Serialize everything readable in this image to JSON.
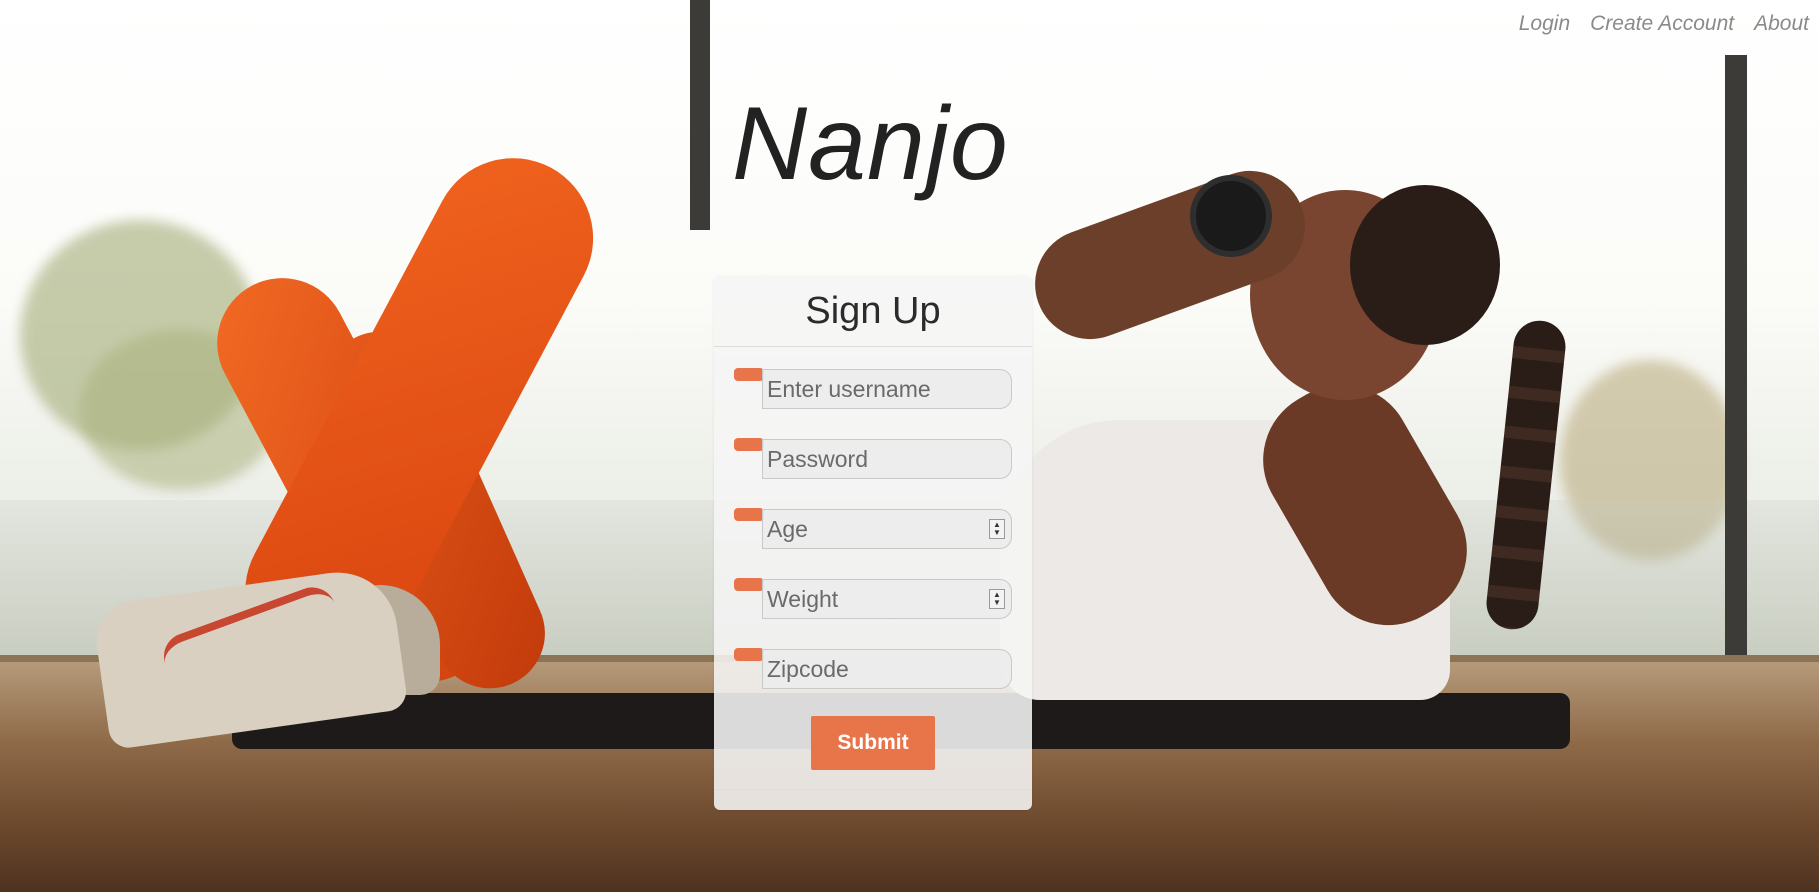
{
  "nav": {
    "links": [
      "Login",
      "Create Account",
      "About"
    ]
  },
  "brand": {
    "title": "Nanjo"
  },
  "form": {
    "title": "Sign Up",
    "fields": [
      {
        "placeholder": "Enter username",
        "type": "text"
      },
      {
        "placeholder": "Password",
        "type": "password"
      },
      {
        "placeholder": "Age",
        "type": "number"
      },
      {
        "placeholder": "Weight",
        "type": "number"
      },
      {
        "placeholder": "Zipcode",
        "type": "text"
      }
    ],
    "submit_label": "Submit"
  },
  "colors": {
    "accent": "#e8744a",
    "nav_text": "#8a8a8a",
    "title_text": "#222222"
  },
  "icons": {
    "spinner": "number-spinner-icon"
  }
}
